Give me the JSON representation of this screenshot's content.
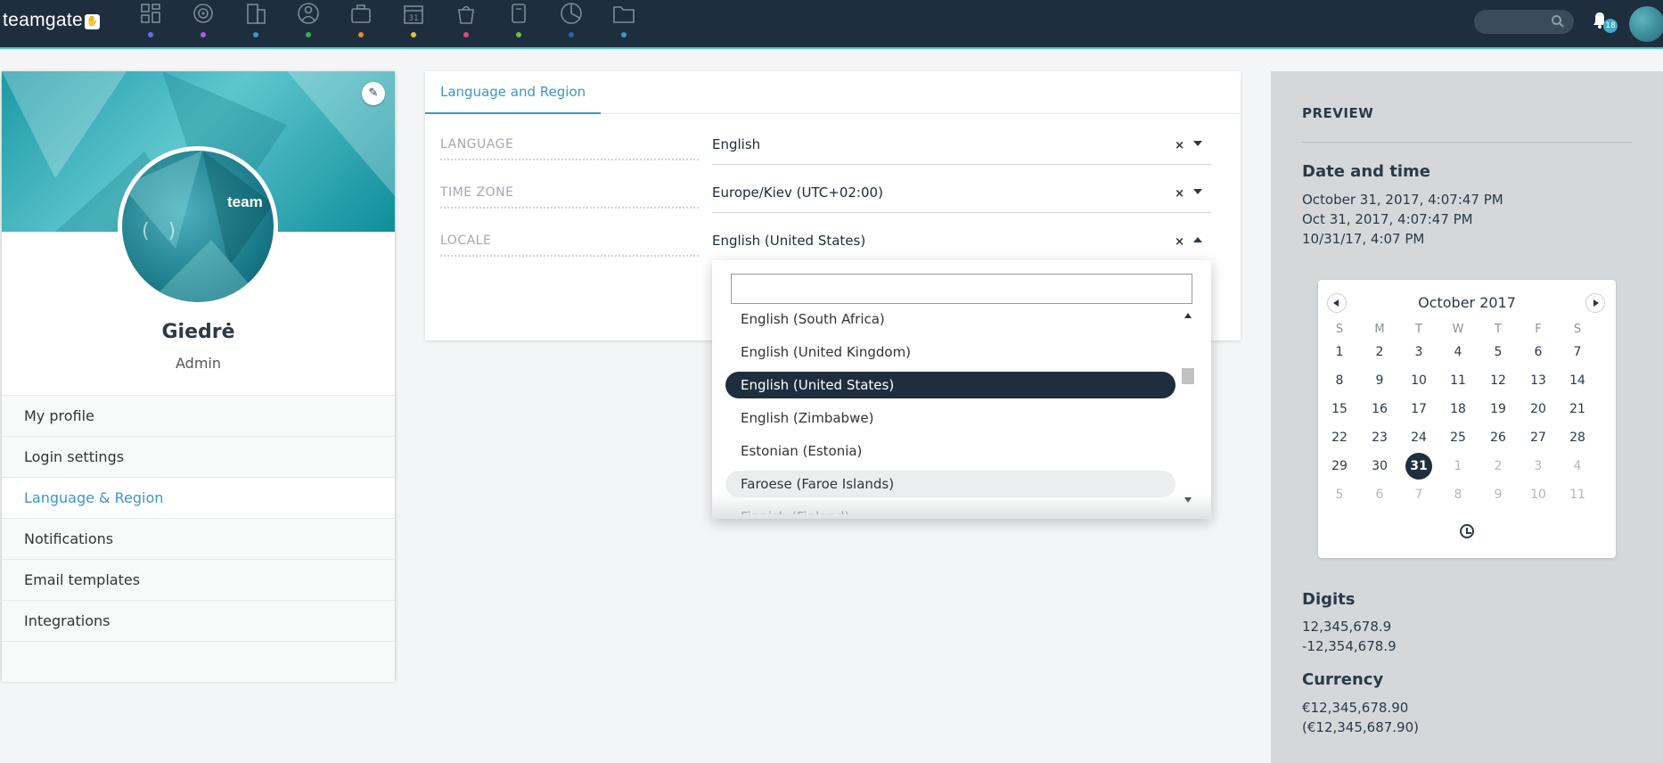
{
  "app": {
    "logo_text": "teamgate",
    "nav_icons": [
      {
        "name": "dashboard-icon",
        "dot": "#6b6ee0"
      },
      {
        "name": "target-icon",
        "dot": "#b05be0"
      },
      {
        "name": "building-icon",
        "dot": "#3d97c2"
      },
      {
        "name": "people-icon",
        "dot": "#2fb04f"
      },
      {
        "name": "briefcase-icon",
        "dot": "#e08a3a"
      },
      {
        "name": "calendar-icon",
        "dot": "#e0c53a"
      },
      {
        "name": "shopping-bag-icon",
        "dot": "#d64f7b"
      },
      {
        "name": "document-icon",
        "dot": "#6cbf3a"
      },
      {
        "name": "pie-chart-icon",
        "dot": "#2a62a8"
      },
      {
        "name": "folder-icon",
        "dot": "#3d97c2"
      }
    ],
    "notifications_count": "18"
  },
  "profile": {
    "avatar_text": "team",
    "name": "Giedrė",
    "role": "Admin",
    "menu": [
      {
        "label": "My profile",
        "active": false
      },
      {
        "label": "Login settings",
        "active": false
      },
      {
        "label": "Language & Region",
        "active": true
      },
      {
        "label": "Notifications",
        "active": false
      },
      {
        "label": "Email templates",
        "active": false
      },
      {
        "label": "Integrations",
        "active": false
      }
    ]
  },
  "form": {
    "tab_label": "Language and Region",
    "fields": [
      {
        "label": "LANGUAGE",
        "value": "English",
        "open": false
      },
      {
        "label": "TIME ZONE",
        "value": "Europe/Kiev (UTC+02:00)",
        "open": false
      },
      {
        "label": "LOCALE",
        "value": "English (United States)",
        "open": true
      }
    ]
  },
  "locale_dropdown": {
    "search_value": "",
    "options": [
      {
        "label": "English (South Africa)",
        "state": "normal"
      },
      {
        "label": "English (United Kingdom)",
        "state": "normal"
      },
      {
        "label": "English (United States)",
        "state": "selected"
      },
      {
        "label": "English (Zimbabwe)",
        "state": "normal"
      },
      {
        "label": "Estonian (Estonia)",
        "state": "normal"
      },
      {
        "label": "Faroese (Faroe Islands)",
        "state": "hover"
      },
      {
        "label": "Finnish (Finland)",
        "state": "partial"
      }
    ]
  },
  "preview": {
    "title": "PREVIEW",
    "date_heading": "Date and time",
    "date_lines": [
      "October 31, 2017, 4:07:47 PM",
      "Oct 31, 2017, 4:07:47 PM",
      "10/31/17, 4:07 PM"
    ],
    "calendar": {
      "month_label": "October 2017",
      "weekdays": [
        "S",
        "M",
        "T",
        "W",
        "T",
        "F",
        "S"
      ],
      "weeks": [
        [
          {
            "d": "1"
          },
          {
            "d": "2"
          },
          {
            "d": "3"
          },
          {
            "d": "4"
          },
          {
            "d": "5"
          },
          {
            "d": "6"
          },
          {
            "d": "7"
          }
        ],
        [
          {
            "d": "8"
          },
          {
            "d": "9"
          },
          {
            "d": "10"
          },
          {
            "d": "11"
          },
          {
            "d": "12"
          },
          {
            "d": "13"
          },
          {
            "d": "14"
          }
        ],
        [
          {
            "d": "15"
          },
          {
            "d": "16"
          },
          {
            "d": "17"
          },
          {
            "d": "18"
          },
          {
            "d": "19"
          },
          {
            "d": "20"
          },
          {
            "d": "21"
          }
        ],
        [
          {
            "d": "22"
          },
          {
            "d": "23"
          },
          {
            "d": "24"
          },
          {
            "d": "25"
          },
          {
            "d": "26"
          },
          {
            "d": "27"
          },
          {
            "d": "28"
          }
        ],
        [
          {
            "d": "29"
          },
          {
            "d": "30"
          },
          {
            "d": "31",
            "today": true
          },
          {
            "d": "1",
            "muted": true
          },
          {
            "d": "2",
            "muted": true
          },
          {
            "d": "3",
            "muted": true
          },
          {
            "d": "4",
            "muted": true
          }
        ],
        [
          {
            "d": "5",
            "muted": true
          },
          {
            "d": "6",
            "muted": true
          },
          {
            "d": "7",
            "muted": true
          },
          {
            "d": "8",
            "muted": true
          },
          {
            "d": "9",
            "muted": true
          },
          {
            "d": "10",
            "muted": true
          },
          {
            "d": "11",
            "muted": true
          }
        ]
      ]
    },
    "digits_heading": "Digits",
    "digits_lines": [
      "12,345,678.9",
      "-12,354,678.9"
    ],
    "currency_heading": "Currency",
    "currency_lines": [
      "€12,345,678.90",
      "(€12,345,687.90)"
    ]
  }
}
